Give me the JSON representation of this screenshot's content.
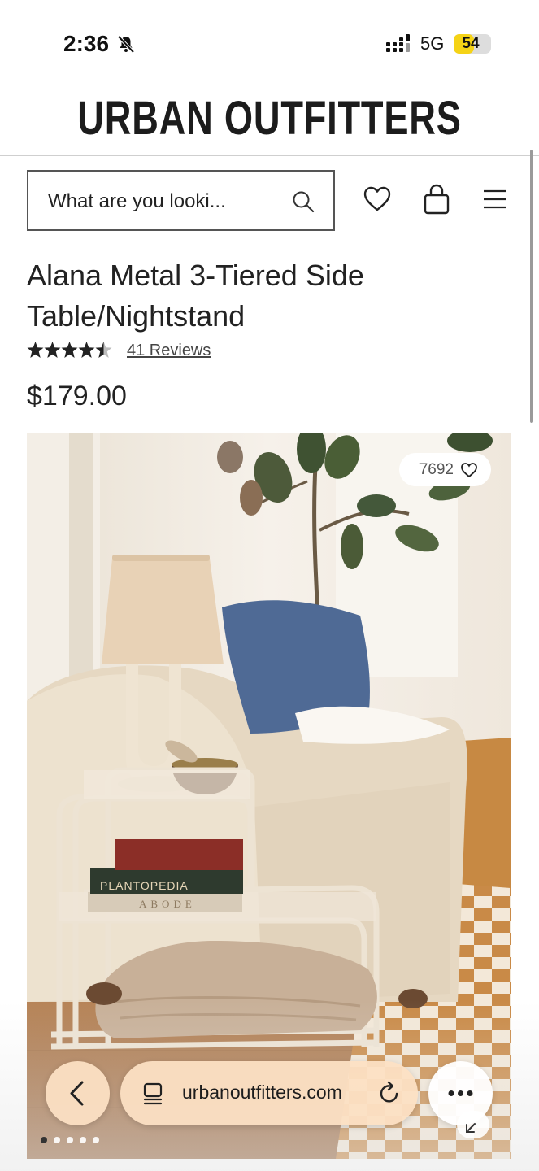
{
  "status_bar": {
    "time": "2:36",
    "network": "5G",
    "battery": "54",
    "battery_level": 0.54
  },
  "brand": {
    "name": "URBAN OUTFITTERS"
  },
  "header": {
    "search_placeholder": "What are you looki...",
    "icons": [
      "search-icon",
      "heart-icon",
      "bag-icon",
      "menu-icon"
    ]
  },
  "product": {
    "title": "Alana Metal 3-Tiered Side Table/Nightstand",
    "rating": 4.5,
    "rating_max": 5,
    "reviews_label": "41 Reviews",
    "price": "$179.00",
    "likes": "7692",
    "book_titles": [
      "PLANTOPEDIA",
      "ABODE"
    ],
    "gallery_count": 5,
    "gallery_active": 1
  },
  "browser": {
    "url": "urbanoutfitters.com",
    "icons": [
      "back-icon",
      "tabs-icon",
      "reload-icon",
      "more-icon",
      "collapse-icon"
    ]
  },
  "colors": {
    "brand_text": "#1c1c1c",
    "battery": "#f5d316",
    "browser_pill": "#fce0c4"
  }
}
